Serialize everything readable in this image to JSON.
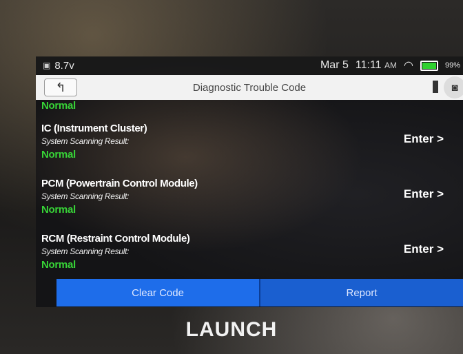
{
  "status_bar": {
    "left_text": "8.7v",
    "date": "Mar 5",
    "time": "11:11",
    "time_suffix": "AM",
    "battery": "99%"
  },
  "title_bar": {
    "title": "Diagnostic Trouble Code"
  },
  "top_status": "Normal",
  "modules": [
    {
      "name": "IC (Instrument Cluster)",
      "subtitle": "System Scanning Result:",
      "status": "Normal",
      "action": "Enter >"
    },
    {
      "name": "PCM (Powertrain Control Module)",
      "subtitle": "System Scanning Result:",
      "status": "Normal",
      "action": "Enter >"
    },
    {
      "name": "RCM (Restraint Control Module)",
      "subtitle": "System Scanning Result:",
      "status": "Normal",
      "action": "Enter >"
    }
  ],
  "buttons": {
    "clear_code": "Clear Code",
    "report": "Report"
  },
  "brand": "LAUNCH",
  "colors": {
    "normal_status": "#37d437",
    "button_blue": "#1e6dea",
    "title_bar_bg": "#f2f2f2"
  }
}
